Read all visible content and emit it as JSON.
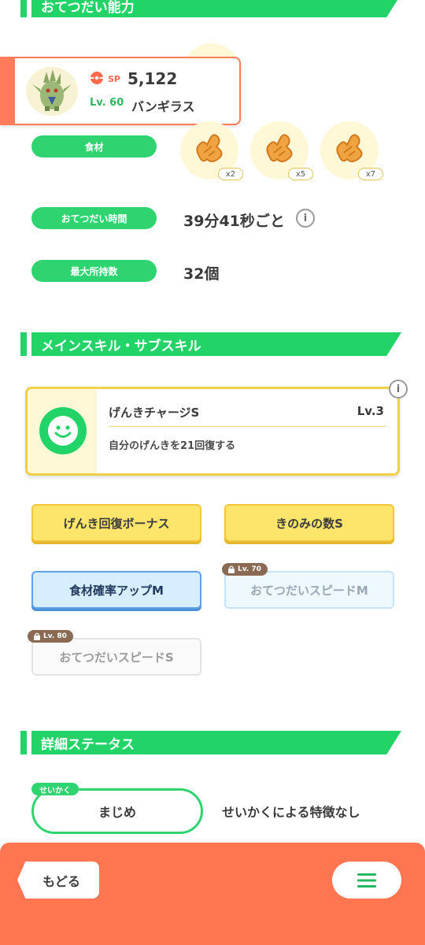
{
  "sections": {
    "ability_title": "おてつだい能力",
    "skills_title": "メインスキル・サブスキル",
    "details_title": "詳細ステータス"
  },
  "pokemon": {
    "sp_label": "SP",
    "sp_value": "5,122",
    "level_label": "Lv. 60",
    "name": "バンギラス"
  },
  "ingredients": {
    "label": "食材",
    "items": [
      {
        "name": "ginger-icon",
        "qty": "x2"
      },
      {
        "name": "ginger-icon",
        "qty": "x5"
      },
      {
        "name": "ginger-icon",
        "qty": "x7"
      }
    ]
  },
  "help_time": {
    "label": "おてつだい時間",
    "value": "39分41秒ごと"
  },
  "max_carry": {
    "label": "最大所持数",
    "value": "32個"
  },
  "main_skill": {
    "name": "げんきチャージS",
    "level": "Lv.3",
    "description": "自分のげんきを21回復する"
  },
  "sub_skills": [
    {
      "label": "げんき回復ボーナス",
      "lock": ""
    },
    {
      "label": "きのみの数S",
      "lock": ""
    },
    {
      "label": "食材確率アップM",
      "lock": ""
    },
    {
      "label": "おてつだいスピードM",
      "lock": "Lv. 70"
    },
    {
      "label": "おてつだいスピードS",
      "lock": "Lv. 80"
    }
  ],
  "nature": {
    "tag": "せいかく",
    "value": "まじめ",
    "effect": "せいかくによる特徴なし"
  },
  "nav": {
    "back_label": "もどる"
  },
  "colors": {
    "green": "#22d468",
    "orange": "#ff7650",
    "gold": "#fde56b"
  }
}
